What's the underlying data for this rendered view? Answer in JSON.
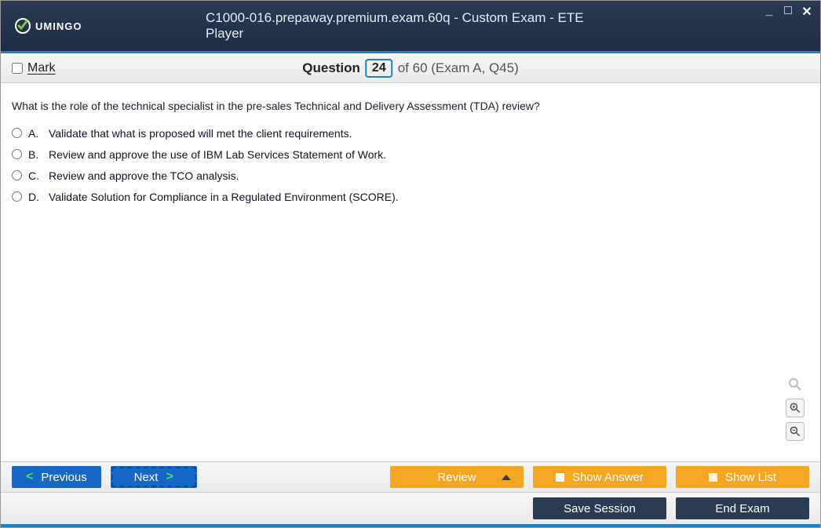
{
  "header": {
    "logo_text": "UMINGO",
    "title": "C1000-016.prepaway.premium.exam.60q - Custom Exam - ETE Player"
  },
  "question_bar": {
    "mark_label": "Mark",
    "question_word": "Question",
    "current": "24",
    "of_text": "of 60 (Exam A, Q45)"
  },
  "question": {
    "text": "What is the role of the technical specialist in the pre-sales Technical and Delivery Assessment (TDA) review?",
    "options": [
      {
        "letter": "A.",
        "text": "Validate that what is proposed will met the client requirements."
      },
      {
        "letter": "B.",
        "text": "Review and approve the use of IBM Lab Services Statement of Work."
      },
      {
        "letter": "C.",
        "text": "Review and approve the TCO analysis."
      },
      {
        "letter": "D.",
        "text": "Validate Solution for Compliance in a Regulated Environment (SCORE)."
      }
    ]
  },
  "footer": {
    "previous": "Previous",
    "next": "Next",
    "review": "Review",
    "show_answer": "Show Answer",
    "show_list": "Show List",
    "save_session": "Save Session",
    "end_exam": "End Exam"
  }
}
